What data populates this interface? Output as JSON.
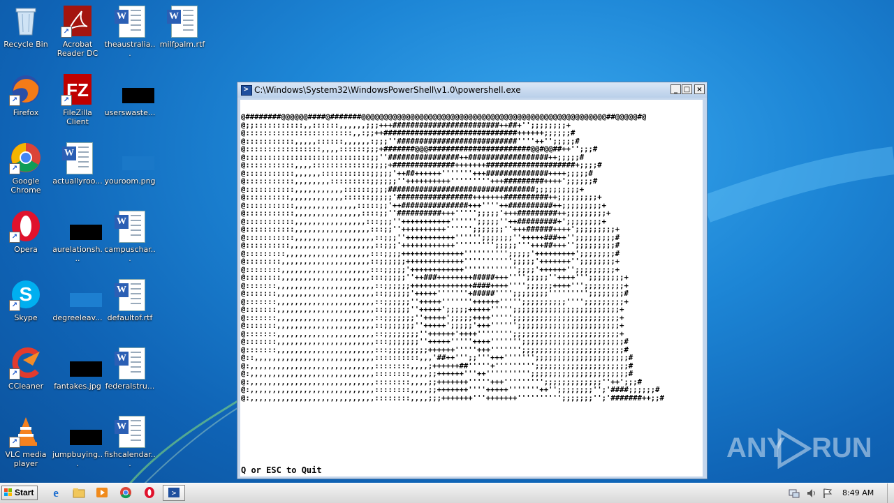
{
  "desktop": {
    "icons": [
      {
        "label": "Recycle Bin"
      },
      {
        "label": "Acrobat Reader DC"
      },
      {
        "label": "theaustralia..."
      },
      {
        "label": "milfpalm.rtf"
      },
      {
        "label": "Firefox"
      },
      {
        "label": "FileZilla Client"
      },
      {
        "label": "userswaste..."
      },
      {
        "label": "Google Chrome"
      },
      {
        "label": "actuallyroo..."
      },
      {
        "label": "youroom.png"
      },
      {
        "label": "Opera"
      },
      {
        "label": "aurelationsh..."
      },
      {
        "label": "campuschar..."
      },
      {
        "label": "Skype"
      },
      {
        "label": "degreeleav..."
      },
      {
        "label": "defaultof.rtf"
      },
      {
        "label": "CCleaner"
      },
      {
        "label": "fantakes.jpg"
      },
      {
        "label": "federalstru..."
      },
      {
        "label": "VLC media player"
      },
      {
        "label": "jumpbuying..."
      },
      {
        "label": "fishcalendar..."
      }
    ]
  },
  "window": {
    "title": "C:\\Windows\\System32\\WindowsPowerShell\\v1.0\\powershell.exe",
    "minimize_label": "_",
    "maximize_label": "□",
    "close_label": "×",
    "ascii_art": "@########@@@@@@####@#######@@@@@@@@@@@@@@@@@@@@@@@@@@@@@@@@@@@@@@@@@@@@@@@@@@@@@@@##@@@@@#@\n@;;:::::::::::,,::::::,,,,,,;;;+++########################++##+'';;;;;;;;+\n@::::::::::::::::::::::::,,:;;++##############################++++++;;;;;;#\n@:::::::::::,,,,,::::::,,,,,,:;;;''###########################''''++'';;;;;#\n@:::::::::::::::::,,,,::::::;;;+#######@@@#######################@@#@@##++'';;;#\n@::::::::::::::::::::::::::::;;''################++##################++;;;;;#\n@:::::::::::,,,,:::::::::::::;;;;+##############+++++++####################+;;;;#\n@:::::::::::,,,,,,:::::::::::;;;;;'++##++++++'''''''+++##############++++;;;;;#\n@:::::::::::,,,,,,,,:::::::::;;;;;;''++++++++++'''''''''+++#########++++';;;;;;#\n@:::::::::::,,,,,,,,,,,::::::;;;;#################################;;;;;;;;;;+\n@::::::::::,,,,,,,,,,,,::::::;;;;;'#################+++++++##########++;;;;;;;;;+\n@:::::::::::,,,,,,,,,,,,,,:::::;;'++###############+++''''++##########++;;;;;;;;;+\n@:::::::::::,,,,,,,,,,,,,,,::::;;''##########+++''''';;;;;'+++#########++;;;;;;;;;+\n@:::::::::::,,,,,,,,,,,,,,,,:::;;;''+++++++++++'''''';;;;;''++#########+';;;;;;;;+\n@:::::::::::,,,,,,,,,,,,,,,,,:::;;''++++++++++'''''';;;;;;;''+++######++++';;;;;;;;;+\n@:::::::::::,,,,,,,,,,,,,,,,,,::;;;''+++++++++++'''''';;;;;;;''+++++###++'';;;;;;;;;#\n@::::::::::,,,,,,,,,,,,,,,,,,,::;;;'++++++++++++''''''''';;;;;'''+++##+++'';;;;;;;;;#\n@:::::::::,,,,,,,,,,,,,,,,,,,:::;;;;++++++++++++++'''''''''';;;;;'+++++++++';;;;;;;;#\n@::::::::,,,,,,,,,,,,,,,,,,,,::;;;;;;+++++++++++++''''''''''';;;;;'+++++++'';;;;;;;;+\n@::::::::,,,,,,,,,,,,,,,,,,,,:::;;;;;'++++++++++++'''''''''''';;;;'++++++'';;;;;;;;;+\n@::::::::,,,,,,,,,,,,,,,,,,,,:::;;;;;''++###++++++++#####+++'''';;;;;''++++''';;;;;;;;+\n@:::::::,,,,,,,,,,,,,,,,,,,,,,::;;;;;;++++++++++++++####++++'''';;;;;;++++''';;;;;;;;;+\n@:::::::,,,,,,,,,,,,,,,,,,,,,,::;;;;;;'+++++'''''''+#####'''';;;;;;;;''''''''';;;;;;;;#\n@:::::::,,,,,,,,,,,,,,,,,,,,,,::;;;;;;''+++++'''''''++++++''''';;;;;;;;;;'''';;;;;;;;;+\n@:::::::,,,,,,,,,,,,,,,,,,,,,,::;;;;;;''+++++';;;;;+++++''''';;;;;;;;;;;;;;;;;;;;;;;;+\n@:::::::,,,,,,,,,,,,,,,,,,,,,,::;;;;;;;''+++++';;;;;++++''''';;;;;;;;;;;;;;;;;;;;;;;;+\n@:::::::,,,,,,,,,,,,,,,,,,,,,,::;;;;;;;''+++++';;;;;'+++'''''';;;;;;;;;;;;;;;;;;;;;;;+\n@:::::::,,,,,,,,,,,,,,,,,,,,,,::;;;;;;;;''++++++'++++'''''''';;;;;;;;;;;;;;;;;;;;;;;;+\n@:::::::,,,,,,,,,,,,,,,,,,,,,,:::;;;;;;;''+++++'''''++++''''''';;;;;;;;;;;;;;;;;;;;;;;#\n@:::::::,,,,,,,,,,,,,,,,,,,,,,:::;;;;;;;;;++++++'''''+++''''''';;;;;;;;;;;;;;;;;;;;;;;#\n@::,,,,,,,,,,,,,,,,,,,,,,,,,,,::::::::::,,,'##++''';;'''+++''''''';;;;;;;;;;;;;;;;;;;;;#\n@:,,,,,,,,,,,,,,,,,,,,,,,,,,,,::::::::,,,,;++++++##'''''+''''''''';;;;;;;;;;;;;;;;;;;;;#\n@:,,,,,,,,,,,,,,,,,,,,,,,,,,,,::::::::,,,,;;++++++'''++'''''''''';;;;;;;;;;;;;;;;;;;;;;#\n@:,,,,,,,,,,,,,,,,,,,,,,,,,,,,::::::::,,,,;;+++++++'''''+++''''''''';;;;;;;;;;;;;''++';;;#\n@:,,,,,,,,,,,,,,,,,,,,,,,,,,,,::::::::,,,,;;+++++++''''+++++'''''''++'';;;;;;;;'';'####;;;;;;#\n@:,,,,,,,,,,,,,,,,,,,,,,,,,,,,::::::::,,,,;;;+++++++'''+++++++'''''''''';;;;;;;'';'#######++;;#",
    "quit_hint": "Q or ESC to Quit"
  },
  "taskbar": {
    "start_label": "Start",
    "clock": "8:49 AM"
  },
  "watermark": {
    "left": "ANY",
    "right": "RUN"
  },
  "colors": {
    "desktop_blue": "#1d86d6",
    "console_bg": "#ffffff",
    "console_text": "#000000"
  }
}
